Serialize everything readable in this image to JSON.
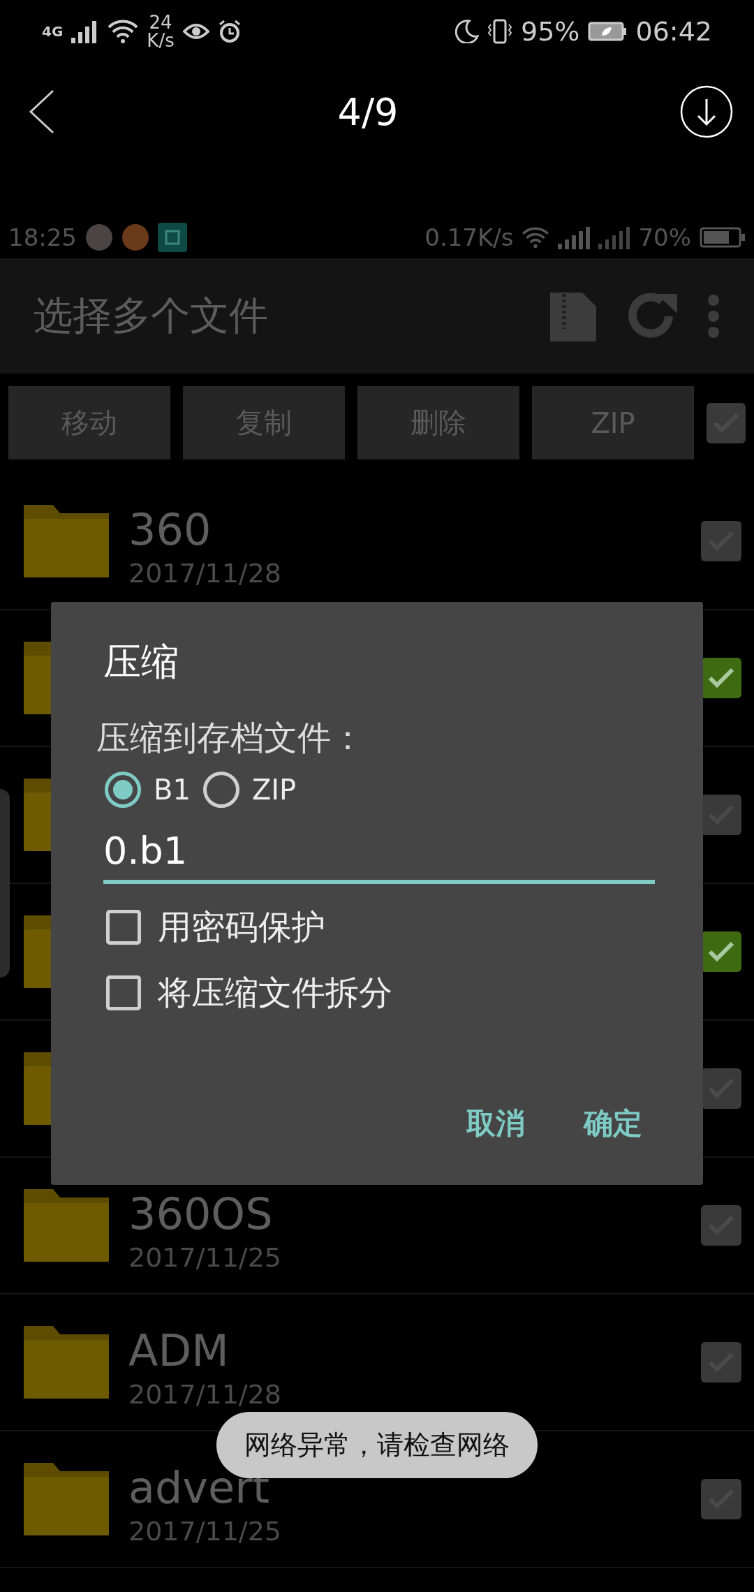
{
  "status_bar": {
    "network": "4G",
    "speed_value": "24",
    "speed_unit": "K/s",
    "battery": "95%",
    "time": "06:42"
  },
  "viewer": {
    "counter": "4/9"
  },
  "screenshot": {
    "status_bar": {
      "time": "18:25",
      "speed": "0.17K/s",
      "battery": "70%"
    },
    "toolbar": {
      "title": "选择多个文件"
    },
    "actions": [
      "移动",
      "复制",
      "删除",
      "ZIP"
    ],
    "select_all": {
      "checked": false
    },
    "files": [
      {
        "name": "360",
        "date": "2017/11/28",
        "checked": false
      },
      {
        "checked": true
      },
      {
        "checked": false
      },
      {
        "checked": true
      },
      {
        "checked": false
      },
      {
        "name": "360OS",
        "date": "2017/11/25",
        "checked": false
      },
      {
        "name": "ADM",
        "date": "2017/11/28",
        "checked": false
      },
      {
        "name": "advert",
        "date": "2017/11/25",
        "checked": false
      }
    ]
  },
  "dialog": {
    "title": "压缩",
    "label": "压缩到存档文件：",
    "formats": [
      {
        "label": "B1",
        "selected": true
      },
      {
        "label": "ZIP",
        "selected": false
      }
    ],
    "filename": "0.b1",
    "options": [
      {
        "label": "用密码保护",
        "checked": false
      },
      {
        "label": "将压缩文件拆分",
        "checked": false
      }
    ],
    "buttons": [
      "取消",
      "确定"
    ]
  },
  "toast": "网络异常，请检查网络"
}
